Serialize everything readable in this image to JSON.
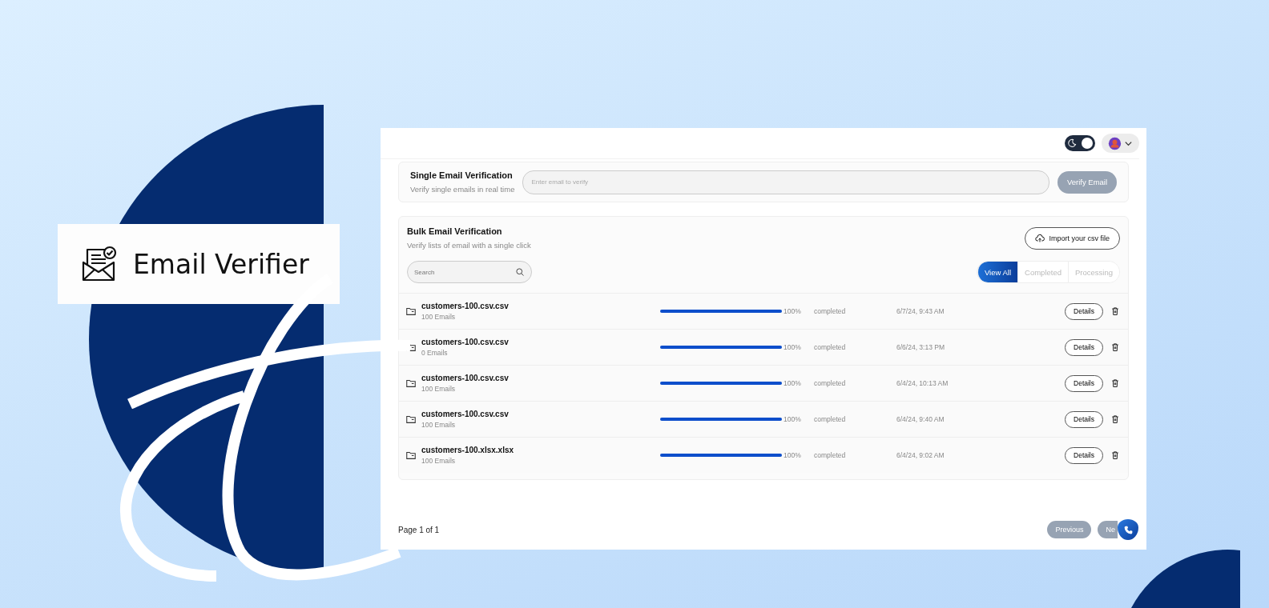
{
  "logo": {
    "title": "Email Verifier"
  },
  "header": {
    "dark_mode_toggle": {
      "on": true
    }
  },
  "single": {
    "title": "Single Email Verification",
    "subtitle": "Verify single emails in real time",
    "input": {
      "placeholder": "Enter email to verify"
    },
    "button": "Verify Email"
  },
  "bulk": {
    "title": "Bulk Email Verification",
    "subtitle": "Verify lists of email with a single click",
    "import_button": "Import your csv file",
    "search": {
      "placeholder": "Search"
    },
    "filters": [
      {
        "label": "View All",
        "selected": true
      },
      {
        "label": "Completed",
        "selected": false
      },
      {
        "label": "Processing",
        "selected": false
      }
    ],
    "files": [
      {
        "name": "customers-100.csv.csv",
        "count": "100 Emails",
        "level": 1,
        "percent": "100%",
        "status": "completed",
        "date": "6/7/24, 9:43 AM",
        "action": "Details"
      },
      {
        "name": "customers-100.csv.csv",
        "count": "0 Emails",
        "level": 1,
        "percent": "100%",
        "status": "completed",
        "date": "6/6/24, 3:13 PM",
        "action": "Details"
      },
      {
        "name": "customers-100.csv.csv",
        "count": "100 Emails",
        "level": 1,
        "percent": "100%",
        "status": "completed",
        "date": "6/4/24, 10:13 AM",
        "action": "Details"
      },
      {
        "name": "customers-100.csv.csv",
        "count": "100 Emails",
        "level": 1,
        "percent": "100%",
        "status": "completed",
        "date": "6/4/24, 9:40 AM",
        "action": "Details"
      },
      {
        "name": "customers-100.xlsx.xlsx",
        "count": "100 Emails",
        "level": 1,
        "percent": "100%",
        "status": "completed",
        "date": "6/4/24, 9:02 AM",
        "action": "Details"
      }
    ]
  },
  "pagination": {
    "label": "Page 1 of 1",
    "buttons": [
      {
        "label": "Previous",
        "disabled": true
      },
      {
        "label": "Ne",
        "disabled": true
      }
    ]
  }
}
